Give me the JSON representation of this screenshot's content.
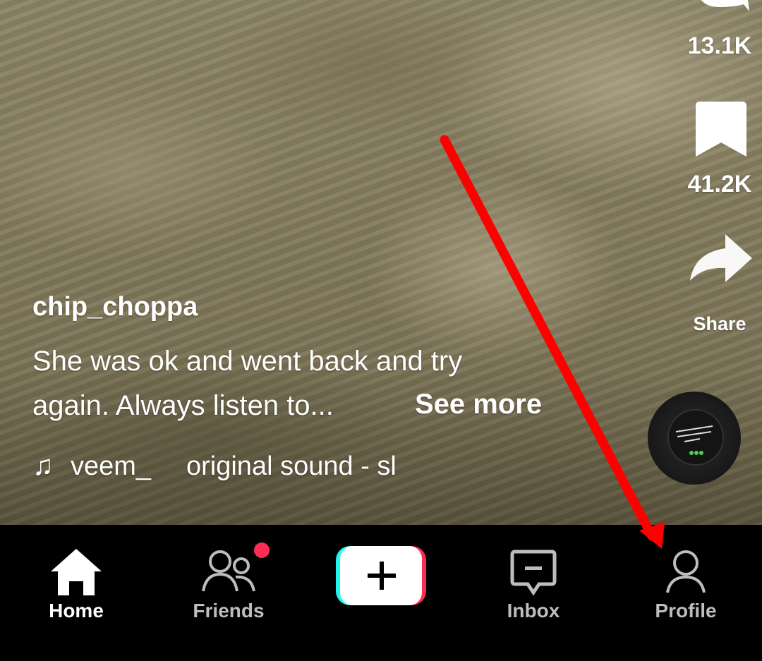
{
  "video": {
    "username": "chip_choppa",
    "caption_line1": "She was ok and went back and try",
    "caption_line2": "again. Always listen to...",
    "see_more": "See more",
    "music_note_icon": "music-note-icon",
    "sound_text_a": "veem_",
    "sound_text_b": "original sound - sl"
  },
  "actions": {
    "comments_count": "13.1K",
    "favorites_count": "41.2K",
    "share_label": "Share"
  },
  "nav": {
    "home": "Home",
    "friends": "Friends",
    "inbox": "Inbox",
    "profile": "Profile"
  },
  "colors": {
    "badge": "#fe2c55",
    "annotation_arrow": "#ff0000",
    "create_left": "#25f4ee",
    "create_right": "#fe2c55"
  }
}
